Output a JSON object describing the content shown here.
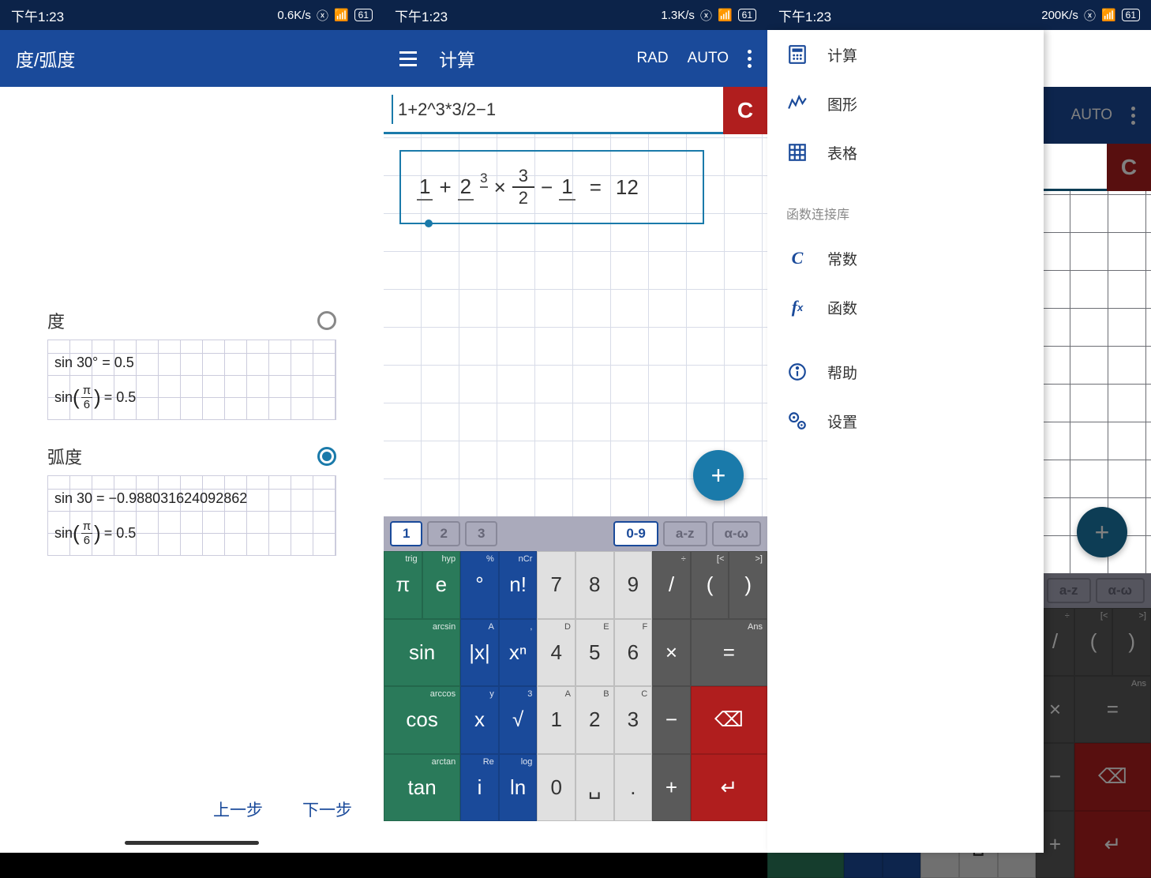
{
  "statusbar": {
    "time": "下午1:23",
    "speed1": "0.6K/s",
    "speed2": "1.3K/s",
    "speed3": "200K/s",
    "battery": "61"
  },
  "phone1": {
    "title": "度/弧度",
    "deg_label": "度",
    "rad_label": "弧度",
    "deg_row1": "sin 30° = 0.5",
    "deg_row2_lhs": "sin",
    "deg_row2_rhs": "= 0.5",
    "rad_row1": "sin 30 = −0.988031624092862",
    "rad_row2_lhs": "sin",
    "rad_row2_rhs": "= 0.5",
    "pi_frac_num": "π",
    "pi_frac_den": "6",
    "prev": "上一步",
    "next": "下一步"
  },
  "phone2": {
    "title": "计算",
    "rad": "RAD",
    "auto": "AUTO",
    "input": "1+2^3*3/2−1",
    "clear": "C",
    "eq_result": "12",
    "tabs": {
      "t1": "1",
      "t2": "2",
      "t3": "3",
      "m1": "0-9",
      "m2": "a-z",
      "m3": "α-ω"
    },
    "keys": {
      "r1": [
        {
          "l": "π",
          "s": "trig",
          "c": "kg"
        },
        {
          "l": "e",
          "s": "hyp",
          "c": "kg"
        },
        {
          "l": "°",
          "s": "%",
          "c": "kb"
        },
        {
          "l": "n!",
          "s": "nCr",
          "c": "kb"
        },
        {
          "l": "7",
          "s": "",
          "c": "kw"
        },
        {
          "l": "8",
          "s": "",
          "c": "kw"
        },
        {
          "l": "9",
          "s": "",
          "c": "kw"
        },
        {
          "l": "/",
          "s": "÷",
          "c": "kd"
        },
        {
          "l": "(",
          "s": "[<",
          "c": "kd"
        },
        {
          "l": ")",
          "s": ">]",
          "c": "kd"
        }
      ],
      "r2": [
        {
          "l": "sin",
          "s": "arcsin",
          "c": "kg"
        },
        {
          "l": "|x|",
          "s": "A",
          "c": "kb"
        },
        {
          "l": "xⁿ",
          "s": ",",
          "c": "kb"
        },
        {
          "l": "4",
          "s": "D",
          "c": "kw"
        },
        {
          "l": "5",
          "s": "E",
          "c": "kw"
        },
        {
          "l": "6",
          "s": "F",
          "c": "kw"
        },
        {
          "l": "×",
          "s": "",
          "c": "kd"
        },
        {
          "l": "=",
          "s": "Ans",
          "c": "kd"
        }
      ],
      "r3": [
        {
          "l": "cos",
          "s": "arccos",
          "c": "kg"
        },
        {
          "l": "x",
          "s": "y",
          "c": "kb"
        },
        {
          "l": "√",
          "s": "3",
          "c": "kb"
        },
        {
          "l": "1",
          "s": "A",
          "c": "kw"
        },
        {
          "l": "2",
          "s": "B",
          "c": "kw"
        },
        {
          "l": "3",
          "s": "C",
          "c": "kw"
        },
        {
          "l": "−",
          "s": "",
          "c": "kd"
        },
        {
          "l": "⌫",
          "s": "",
          "c": "kr"
        }
      ],
      "r4": [
        {
          "l": "tan",
          "s": "arctan",
          "c": "kg"
        },
        {
          "l": "i",
          "s": "Re",
          "c": "kb"
        },
        {
          "l": "ln",
          "s": "log",
          "c": "kb"
        },
        {
          "l": "0",
          "s": "",
          "c": "kw"
        },
        {
          "l": "␣",
          "s": "",
          "c": "kw"
        },
        {
          "l": ".",
          "s": "",
          "c": "kw"
        },
        {
          "l": "+",
          "s": "",
          "c": "kd"
        },
        {
          "l": "↵",
          "s": "",
          "c": "kr"
        }
      ]
    }
  },
  "phone3": {
    "auto": "AUTO",
    "drawer": {
      "calc": "计算",
      "graph": "图形",
      "table": "表格",
      "section": "函数连接库",
      "const": "常数",
      "func": "函数",
      "help": "帮助",
      "settings": "设置"
    }
  }
}
